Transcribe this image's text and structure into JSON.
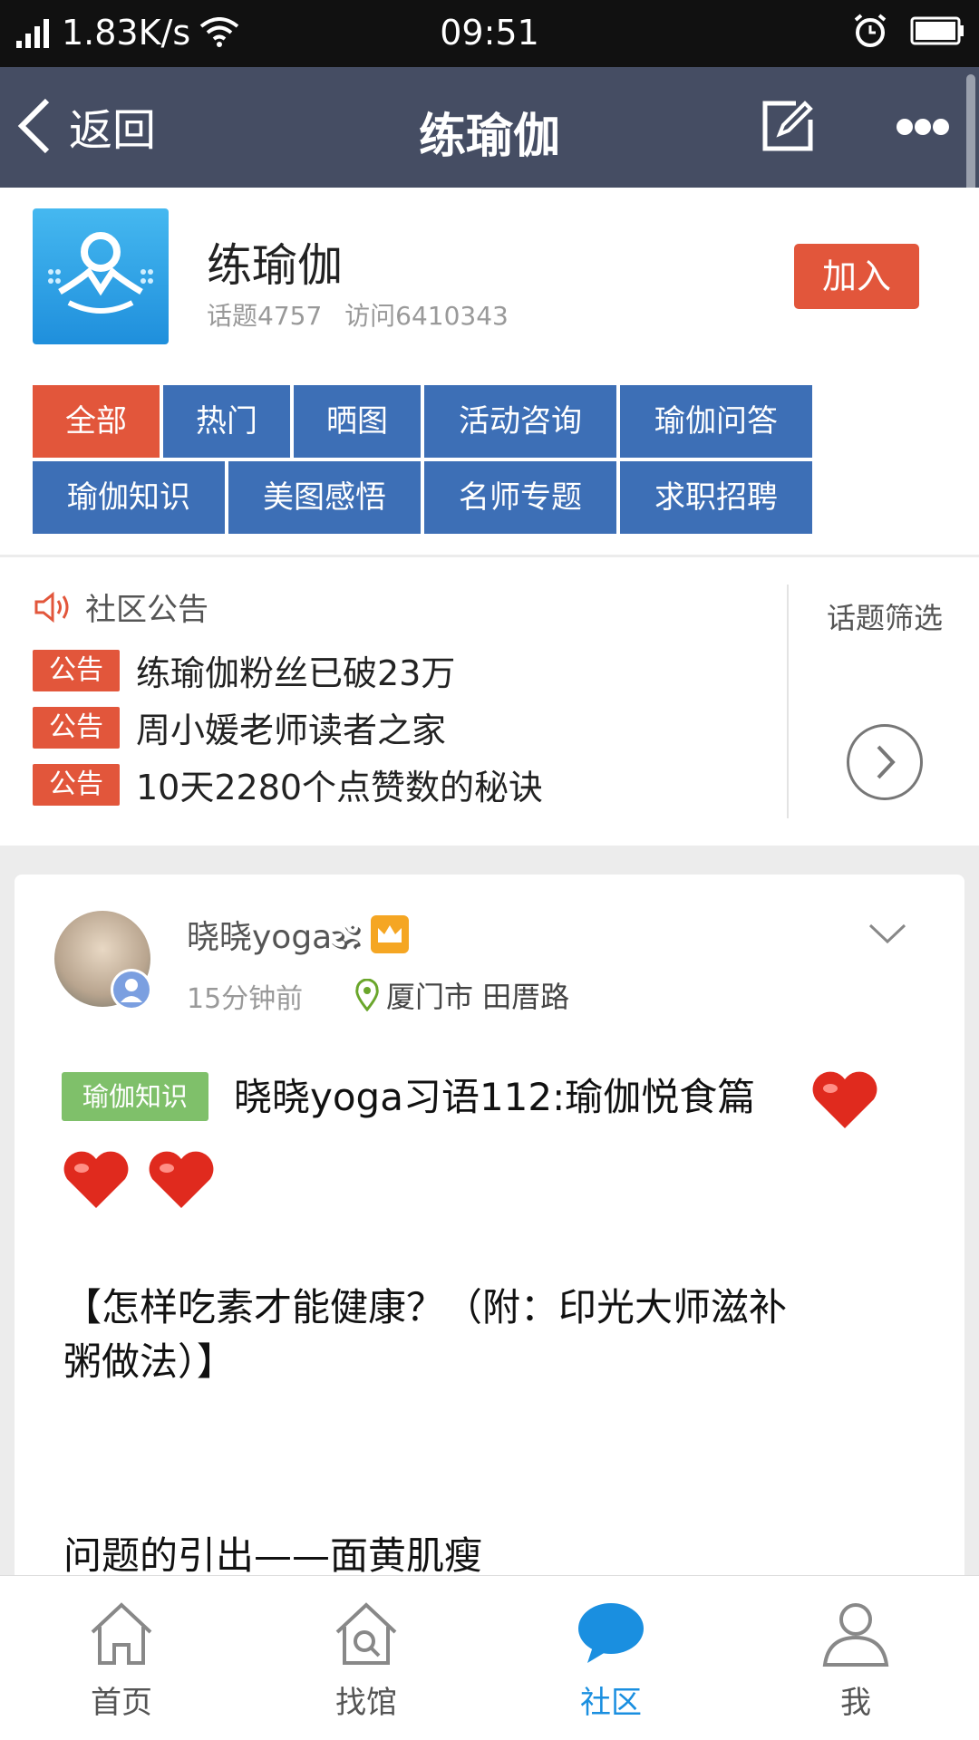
{
  "status_bar": {
    "net_speed": "1.83K/s",
    "time": "09:51",
    "icons": [
      "signal-icon",
      "wifi-icon",
      "alarm-icon",
      "battery-icon"
    ]
  },
  "nav": {
    "back_label": "返回",
    "title": "练瑜伽",
    "icons": [
      "back-arrow-icon",
      "edit-icon",
      "more-icon"
    ]
  },
  "group": {
    "name": "练瑜伽",
    "topics": "话题4757",
    "visits": "访问6410343",
    "join_label": "加入"
  },
  "tags": [
    {
      "label": "全部",
      "active": true
    },
    {
      "label": "热门"
    },
    {
      "label": "晒图"
    },
    {
      "label": "活动咨询"
    },
    {
      "label": "瑜伽问答"
    },
    {
      "label": "瑜伽知识"
    },
    {
      "label": "美图感悟"
    },
    {
      "label": "名师专题"
    },
    {
      "label": "求职招聘"
    }
  ],
  "notice": {
    "head": "社区公告",
    "filter_label": "话题筛选",
    "badge": "公告",
    "items": [
      "练瑜伽粉丝已破23万",
      "周小媛老师读者之家",
      "10天2280个点赞数的秘诀"
    ]
  },
  "post": {
    "author": "晓晓yoga🕉",
    "time": "15分钟前",
    "location": "厦门市 田厝路",
    "category": "瑜伽知识",
    "title": "晓晓yoga习语112:瑜伽悦食篇",
    "body_line1": "【怎样吃素才能健康？（附：印光大师滋补",
    "body_line2": "粥做法）】",
    "body_line3": "问题的引出——面黄肌瘦"
  },
  "tabbar": [
    {
      "label": "首页",
      "icon": "home-icon"
    },
    {
      "label": "找馆",
      "icon": "find-venue-icon"
    },
    {
      "label": "社区",
      "icon": "community-chat-icon",
      "active": true
    },
    {
      "label": "我",
      "icon": "profile-icon"
    }
  ],
  "colors": {
    "nav_bg": "#454d63",
    "accent_red": "#e2563b",
    "tag_blue": "#3d6fb6",
    "active_tab_blue": "#1a8fe0",
    "category_green": "#7fc06a"
  }
}
